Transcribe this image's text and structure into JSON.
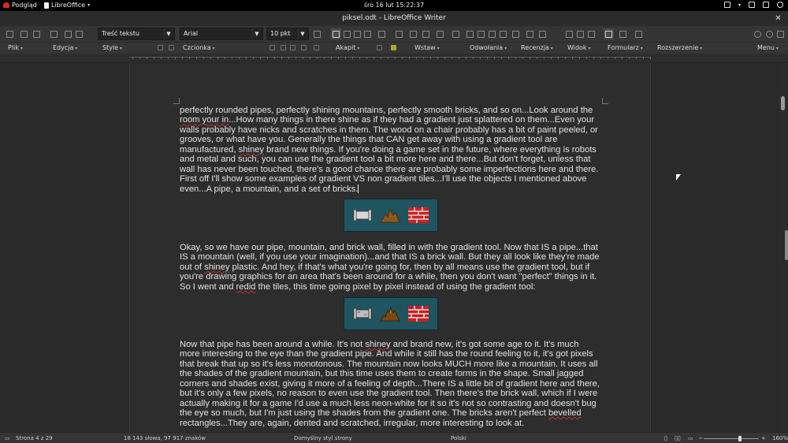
{
  "topbar": {
    "activities": "Podgląd",
    "app": "LibreOffice",
    "clock": "śro 16 lut  15:22:37"
  },
  "window": {
    "title": "piksel.odt - LibreOffice Writer"
  },
  "toolbar": {
    "paragraph_style": "Treść tekstu",
    "font_name": "Arial",
    "font_size": "10 pkt"
  },
  "menus": [
    "Plik",
    "Edycja",
    "Style",
    "Czcionka",
    "Akapit",
    "Wstaw",
    "Odwołania",
    "Recenzja",
    "Widok",
    "Formularz",
    "Rozszerzenie",
    "Menu"
  ],
  "document": {
    "p1": [
      {
        "t": "perfectly rounded pipes, perfectly shining mountains, perfectly smooth bricks, and so on...Look around the "
      },
      {
        "t": "room your in",
        "s": 1
      },
      {
        "t": "...How many things in there shine as if they had a gradient just splattered on them...Even your "
      },
      {
        "t": "walls probably have nicks and scratches in them. The wood on a chair probably has a bit of paint peeled, or "
      },
      {
        "t": "grooves, or what have you. Generally the things that CAN get away with using a gradient tool are "
      },
      {
        "t": "manufactured, "
      },
      {
        "t": "shiney",
        "s": 1
      },
      {
        "t": " brand new things. If you're doing a game set in the future, where everything is robots "
      },
      {
        "t": "and metal and such, you can use the gradient tool a bit more here and there...But don't forget, unless that "
      },
      {
        "t": "wall has never been touched, there's a good chance there are probably some imperfections here and there. "
      },
      {
        "t": "First off I'll show some examples of gradient VS non gradient tiles...I'll use the objects I mentioned above "
      },
      {
        "t": "even...A pipe, a mountain, and a set of bricks."
      }
    ],
    "p2": [
      {
        "t": "Okay, so we have our pipe, mountain, and brick wall, filled in with the gradient tool. Now that IS a pipe...that "
      },
      {
        "t": "IS a mountain (well, if you use your imagination)...and that IS a brick wall. But they all look like they're made "
      },
      {
        "t": "out of "
      },
      {
        "t": "shiney",
        "s": 1
      },
      {
        "t": " plastic. And hey, if that's what you're going for, then by all means use the gradient tool, but if "
      },
      {
        "t": "you're drawing graphics for an area that's been around for a while, then you don't want \"perfect\" things in it. "
      },
      {
        "t": "So I went and "
      },
      {
        "t": "redid",
        "s": 1
      },
      {
        "t": " the tiles, this time going pixel by pixel instead of using the gradient tool:"
      }
    ],
    "p3": [
      {
        "t": "Now that pipe has been around a while. It's not "
      },
      {
        "t": "shiney",
        "s": 1
      },
      {
        "t": " and brand new, it's got some age to it. It's much more "
      },
      {
        "t": "interesting to the eye than the gradient pipe. And while it still has the round feeling to it, it's got pixels that "
      },
      {
        "t": "break that up so it's less monotonous. The mountain now looks MUCH more like a mountain. It uses all the "
      },
      {
        "t": "shades of the gradient mountain, but this time uses them to create forms in the shape. Small jagged corners "
      },
      {
        "t": "and shades exist, giving it more of a feeling of depth...There IS a little bit of gradient here and there, but it's "
      },
      {
        "t": "only a few pixels, no reason to even use the gradient tool. Then there's the brick wall, which if I were actually "
      },
      {
        "t": "making it for a game I'd use a much less neon-white for it so it's not so contrasting and doesn't bug the eye "
      },
      {
        "t": "so much, but I'm just using the shades from the gradient one. The bricks aren't perfect "
      },
      {
        "t": "bevelled",
        "s": 1
      },
      {
        "t": " "
      },
      {
        "t": "rectangles...They are, again, dented and scratched, irregular, more interesting to look at."
      }
    ],
    "images": [
      {
        "name": "gradient-tiles",
        "icons": [
          "pipe-icon",
          "mountain-icon",
          "brick-wall-icon"
        ]
      },
      {
        "name": "pixel-tiles",
        "icons": [
          "pipe-icon",
          "mountain-icon",
          "brick-wall-icon"
        ]
      }
    ]
  },
  "status": {
    "page": "Strona 4 z 29",
    "words": "18 143 słowa, 97 917 znaków",
    "page_style": "Domyślny styl strony",
    "language": "Polski",
    "zoom": "160%"
  },
  "colors": {
    "tile_bg": "#1f5460",
    "accent_red": "#e0281d",
    "spell_underline": "#c0392b"
  }
}
